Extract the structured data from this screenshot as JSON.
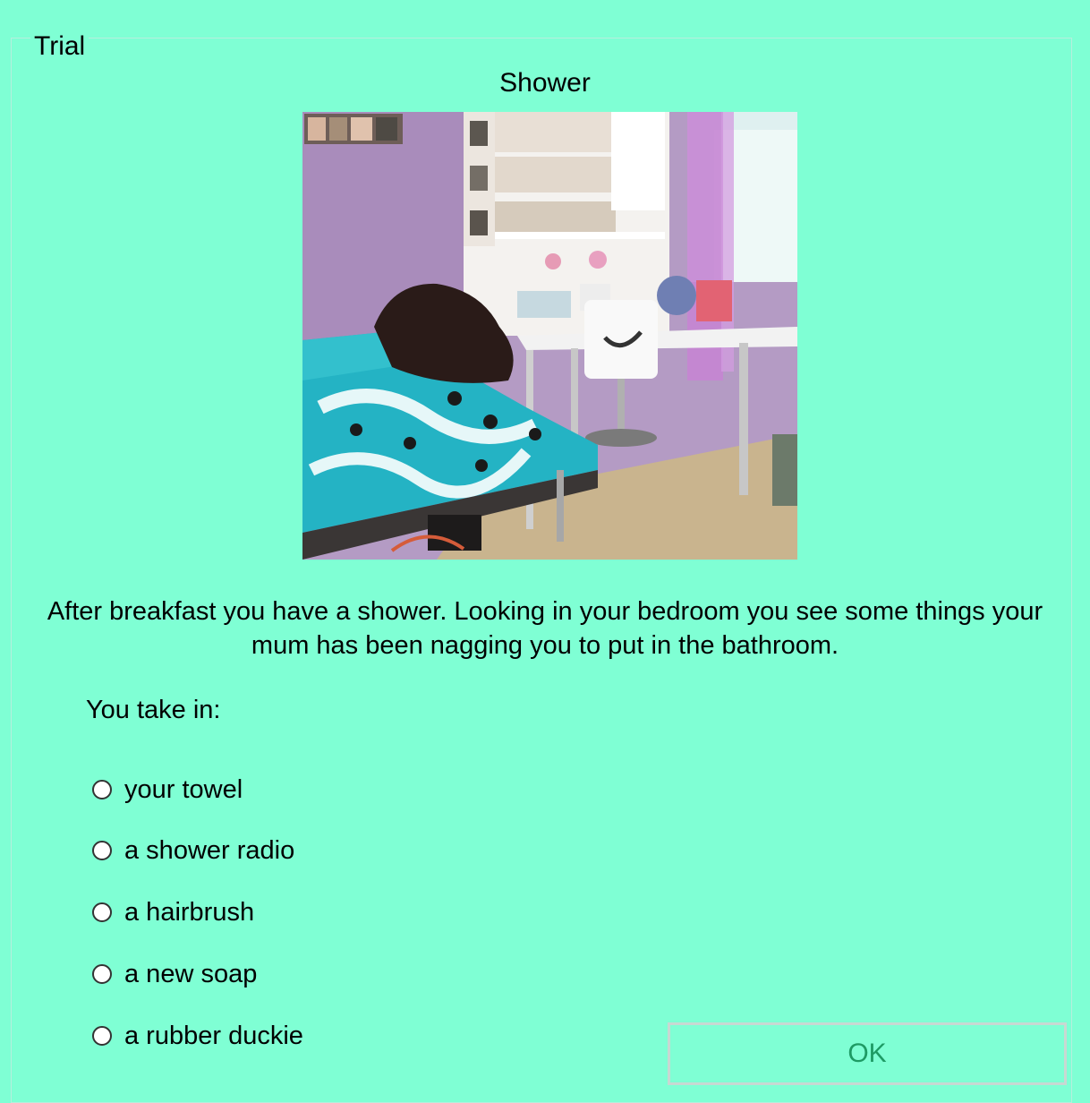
{
  "window": {
    "group_title": "Trial",
    "background_color": "#7fffd4"
  },
  "scene": {
    "title": "Shower",
    "image_description_icon": "bedroom-photo"
  },
  "instructions": "After breakfast you have a shower. Looking in your bedroom you see some things your mum has been nagging you to put in the bathroom.",
  "prompt": "You take in:",
  "options": [
    {
      "label": "your towel",
      "selected": false
    },
    {
      "label": "a shower radio",
      "selected": false
    },
    {
      "label": "a hairbrush",
      "selected": false
    },
    {
      "label": "a new soap",
      "selected": false
    },
    {
      "label": "a rubber duckie",
      "selected": false
    }
  ],
  "ok_button": {
    "label": "OK",
    "text_color": "#1e9a64"
  }
}
